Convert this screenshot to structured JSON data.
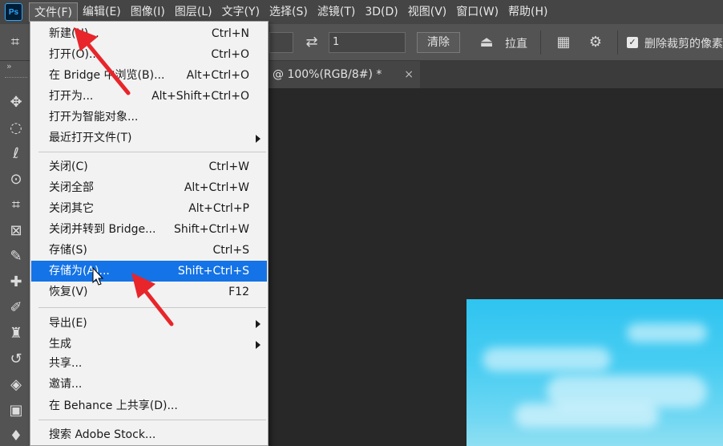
{
  "app": {
    "logo_text": "Ps"
  },
  "menubar": {
    "items": [
      "文件(F)",
      "编辑(E)",
      "图像(I)",
      "图层(L)",
      "文字(Y)",
      "选择(S)",
      "滤镜(T)",
      "3D(D)",
      "视图(V)",
      "窗口(W)",
      "帮助(H)"
    ]
  },
  "options": {
    "field1_value": "",
    "field2_value": "1",
    "clear_label": "清除",
    "straighten_label": "拉直",
    "delete_pixels_label": "删除裁剪的像素",
    "delete_pixels_checked": true
  },
  "toolbar": {
    "collapse_glyph": "»"
  },
  "document": {
    "tab_label": "@ 100%(RGB/8#) *",
    "close_glyph": "×"
  },
  "file_menu": {
    "items": [
      {
        "label": "新建(N)...",
        "shortcut": "Ctrl+N"
      },
      {
        "label": "打开(O)...",
        "shortcut": "Ctrl+O"
      },
      {
        "label": "在 Bridge 中浏览(B)...",
        "shortcut": "Alt+Ctrl+O"
      },
      {
        "label": "打开为...",
        "shortcut": "Alt+Shift+Ctrl+O"
      },
      {
        "label": "打开为智能对象...",
        "shortcut": ""
      },
      {
        "label": "最近打开文件(T)",
        "shortcut": "",
        "submenu": true
      },
      {
        "label": "关闭(C)",
        "shortcut": "Ctrl+W"
      },
      {
        "label": "关闭全部",
        "shortcut": "Alt+Ctrl+W"
      },
      {
        "label": "关闭其它",
        "shortcut": "Alt+Ctrl+P"
      },
      {
        "label": "关闭并转到 Bridge...",
        "shortcut": "Shift+Ctrl+W"
      },
      {
        "label": "存储(S)",
        "shortcut": "Ctrl+S"
      },
      {
        "label": "存储为(A)...",
        "shortcut": "Shift+Ctrl+S",
        "highlighted": true
      },
      {
        "label": "恢复(V)",
        "shortcut": "F12"
      },
      {
        "label": "导出(E)",
        "shortcut": "",
        "submenu": true
      },
      {
        "label": "生成",
        "shortcut": "",
        "submenu": true
      },
      {
        "label": "共享...",
        "shortcut": ""
      },
      {
        "label": "邀请...",
        "shortcut": ""
      },
      {
        "label": "在 Behance 上共享(D)...",
        "shortcut": ""
      },
      {
        "label": "搜索 Adobe Stock...",
        "shortcut": ""
      }
    ]
  },
  "colors": {
    "highlight": "#1473e6",
    "annotation_arrow": "#e8252b",
    "menu_bg": "#f2f2f2"
  }
}
